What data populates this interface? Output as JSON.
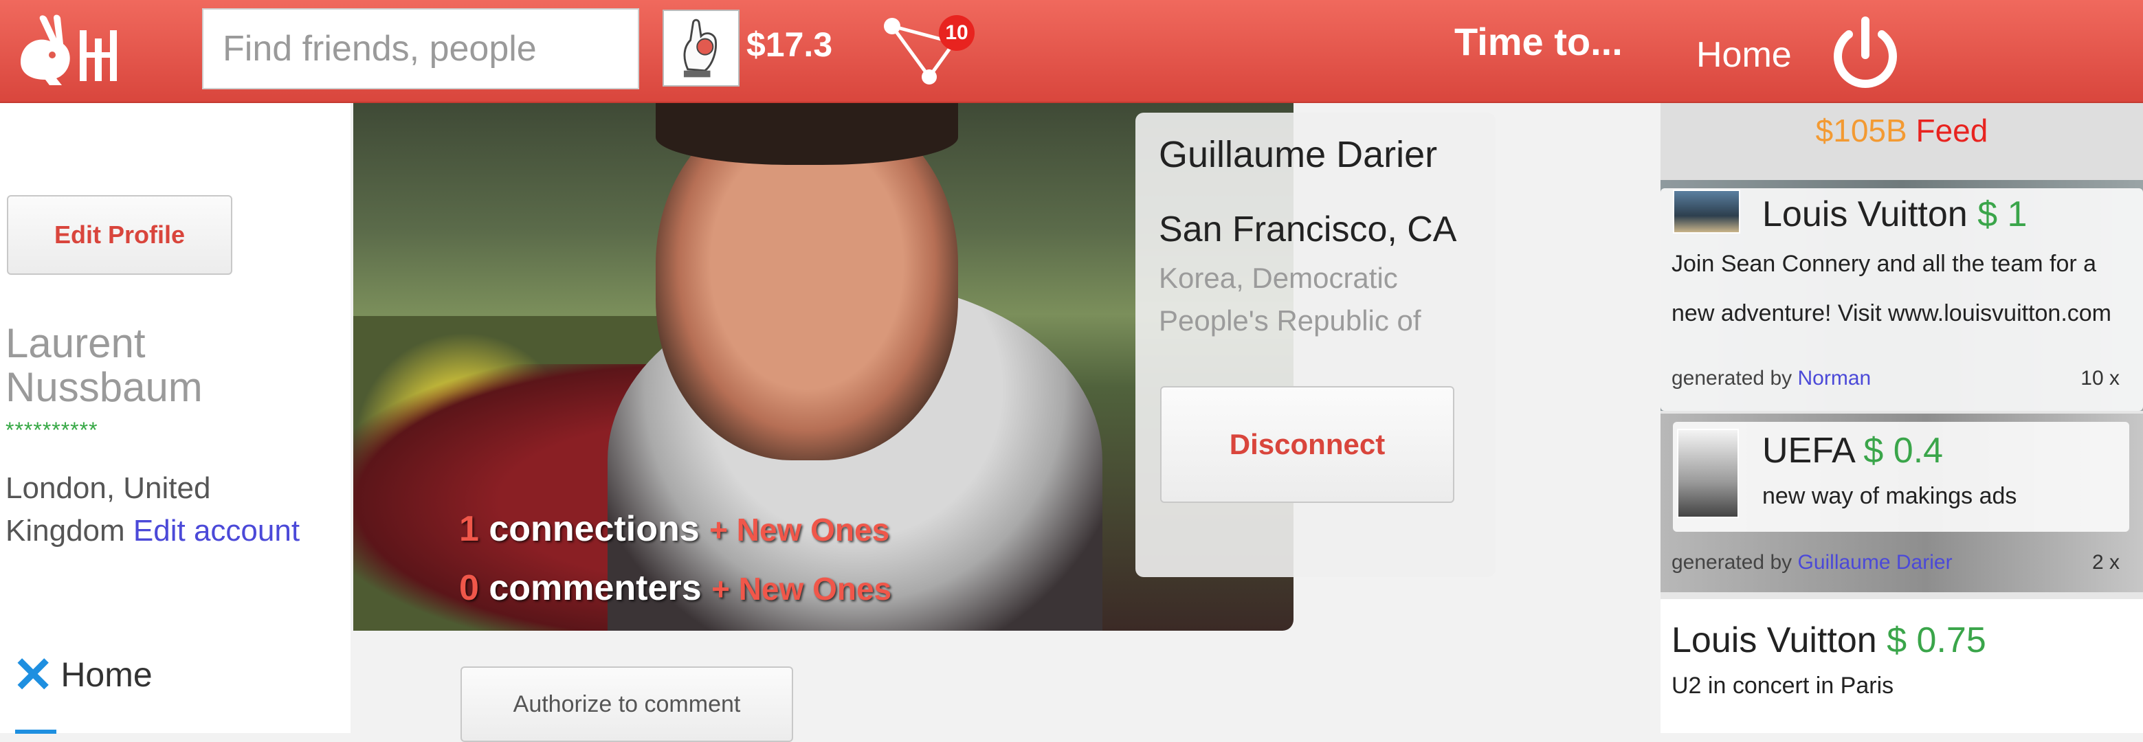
{
  "header": {
    "search_placeholder": "Find friends, people",
    "balance": "$17.3",
    "notification_count": "10",
    "tagline": "Time to...",
    "home_label": "Home"
  },
  "sidebar": {
    "edit_profile_label": "Edit Profile",
    "user_name": "Laurent Nussbaum",
    "rating_stars": "**********",
    "location": "London, United Kingdom",
    "edit_account_label": "Edit account",
    "nav_home_label": "Home"
  },
  "cover": {
    "connections_count": "1",
    "connections_label": "connections",
    "connections_new": "+ New Ones",
    "commenters_count": "0",
    "commenters_label": "commenters",
    "commenters_new": "+ New Ones"
  },
  "profile_card": {
    "name": "Guillaume Darier",
    "city": "San Francisco, CA",
    "country": "Korea, Democratic People's Republic of",
    "disconnect_label": "Disconnect"
  },
  "authorize_label": "Authorize to comment",
  "feed": {
    "total": "$105B",
    "label": "Feed",
    "items": [
      {
        "brand": "Louis Vuitton",
        "price": "$ 1",
        "description": "Join Sean Connery and all the team for a new adventure! Visit www.louisvuitton.com",
        "generated_by_label": "generated by",
        "generated_by": "Norman",
        "count": "10 x"
      },
      {
        "brand": "UEFA",
        "price": "$ 0.4",
        "description": "new way of makings ads",
        "generated_by_label": "generated by",
        "generated_by": "Guillaume Darier",
        "count": "2 x"
      },
      {
        "brand": "Louis Vuitton",
        "price": "$ 0.75",
        "description": "U2 in concert in Paris"
      }
    ]
  },
  "colors": {
    "brand_red": "#e8554a",
    "price_green": "#3aa54a",
    "link_blue": "#4b49d8",
    "feed_total_orange": "#f39a32"
  },
  "icons": [
    "rabbit-logo-icon",
    "wallet-hand-icon",
    "network-icon",
    "power-icon",
    "close-x-icon"
  ]
}
